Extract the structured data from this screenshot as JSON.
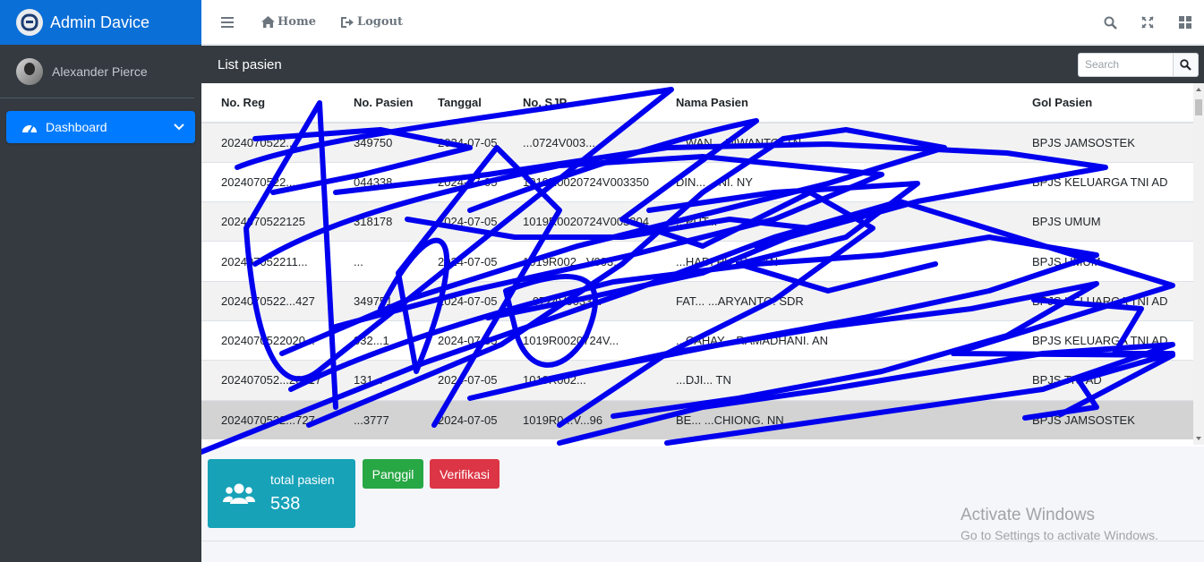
{
  "brand": {
    "title": "Admin Davice"
  },
  "user": {
    "name": "Alexander Pierce"
  },
  "sidebar": {
    "items": [
      {
        "label": "Dashboard"
      }
    ]
  },
  "topbar": {
    "home_label": "Home",
    "logout_label": "Logout"
  },
  "card": {
    "title": "List pasien",
    "search_placeholder": "Search",
    "columns": [
      "No. Reg",
      "No. Pasien",
      "Tanggal",
      "No. SJP",
      "Nama Pasien",
      "Gol Pasien"
    ],
    "rows": [
      [
        "2024070522...",
        "349750",
        "2024-07-05",
        "...0724V003...",
        "...WAN ...DIWANTO. TN",
        "BPJS JAMSOSTEK"
      ],
      [
        "2024070522...",
        "044338",
        "2024-07-05",
        "1019R0020724V003350",
        "DIN... ...NI. NY",
        "BPJS KELUARGA TNI AD"
      ],
      [
        "2024070522125",
        "318178",
        "2024-07-05",
        "1019R0020724V003304",
        "...PUT...",
        "BPJS UMUM"
      ],
      [
        "202407052211...",
        "...",
        "2024-07-05",
        "1019R002...V003...",
        "...HADI PUTRA. AN",
        "BPJS UMUM"
      ],
      [
        "2024070522...427",
        "349751",
        "2024-07-05",
        "...0724V0033...",
        "FAT... ...ARYANTO. SDR",
        "BPJS KELUARGA TNI AD"
      ],
      [
        "2024070522020...",
        "032...1",
        "2024-07-05",
        "1019R0020724V...",
        "...CAHAY... RAMADHANI. AN",
        "BPJS KELUARGA TNI AD"
      ],
      [
        "202407052...20017",
        "131...",
        "2024-07-05",
        "1019R002...",
        "...DJI... TN",
        "BPJS TNI AD"
      ],
      [
        "2024070522...727",
        "...3777",
        "2024-07-05",
        "1019R0...V...96",
        "BE... ...CHIONG. NN",
        "BPJS JAMSOSTEK"
      ]
    ]
  },
  "stats": {
    "total_label": "total pasien",
    "total_value": "538"
  },
  "actions": {
    "call_label": "Panggil",
    "verify_label": "Verifikasi"
  },
  "watermark": {
    "line1": "Activate Windows",
    "line2": "Go to Settings to activate Windows."
  },
  "colors": {
    "brand": "#0b6fd8",
    "sidebar": "#343a40",
    "primary": "#007bff",
    "info": "#17a2b8",
    "success": "#28a745",
    "danger": "#dc3545",
    "scribble": "#0000ee"
  },
  "icons": [
    "hamburger-icon",
    "home-icon",
    "logout-icon",
    "search-icon",
    "expand-icon",
    "grid-icon",
    "dashboard-icon",
    "chevron-down-icon",
    "users-icon"
  ]
}
